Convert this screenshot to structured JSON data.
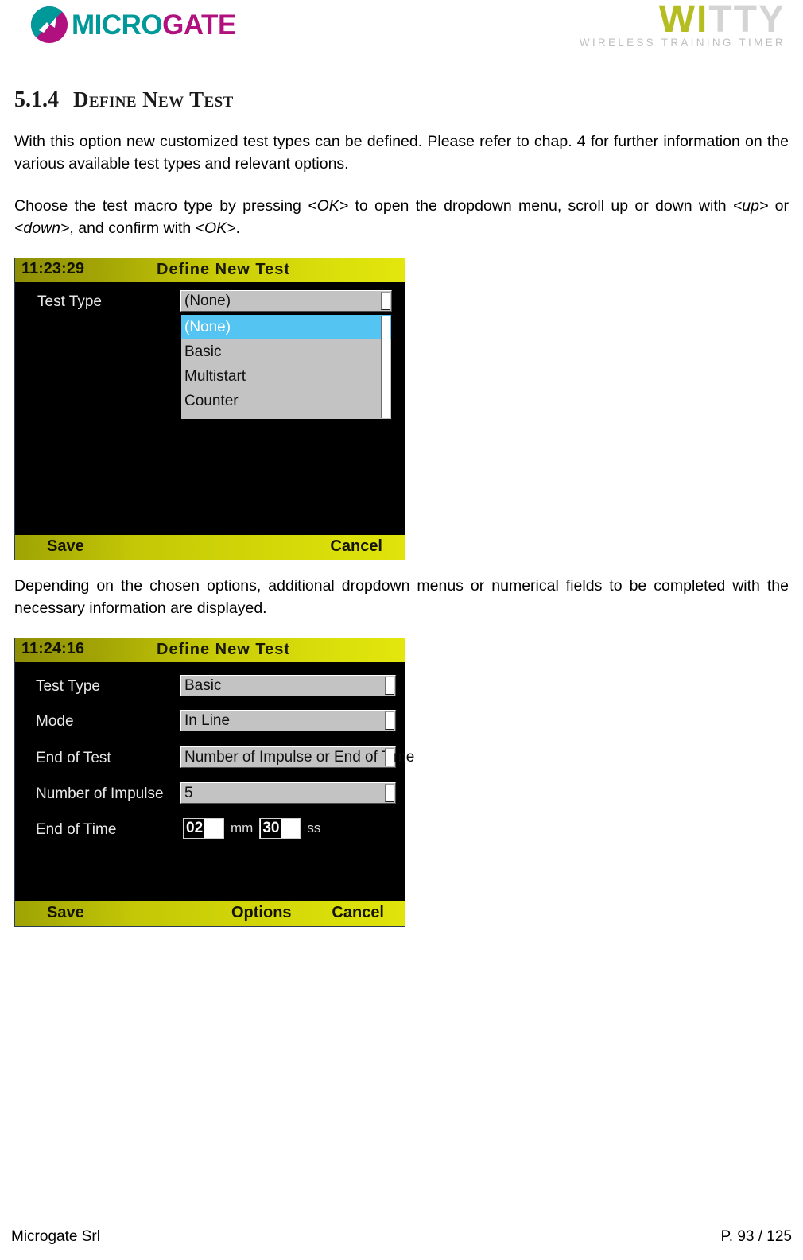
{
  "header": {
    "microgate_logo": {
      "icon": "microgate-circle-mark",
      "word_part1": "MICRO",
      "word_part2": "GATE"
    },
    "witty_logo": {
      "word_part1": "WI",
      "word_part2": "TTY",
      "tagline": "WIRELESS  TRAINING  TIMER"
    }
  },
  "section": {
    "number": "5.1.4",
    "title": "Define New Test"
  },
  "paragraphs": {
    "p1": "With this option new customized test types can be defined. Please refer to chap. 4 for further information on the various available test types and relevant options.",
    "p2_a": "Choose the test macro type by pressing ",
    "p2_ok1": "<OK>",
    "p2_b": " to open the dropdown menu, scroll up or down with ",
    "p2_up": "<up>",
    "p2_c": " or ",
    "p2_down": "<down>",
    "p2_d": ", and confirm with ",
    "p2_ok2": "<OK>",
    "p2_e": ".",
    "p3": "Depending on the chosen options, additional dropdown menus or numerical fields to be completed with the necessary information are displayed."
  },
  "screen1": {
    "time": "11:23:29",
    "title": "Define  New  Test",
    "field_label": "Test Type",
    "combo_value": "(None)",
    "dropdown_options": [
      {
        "label": "(None)",
        "selected": true
      },
      {
        "label": "Basic",
        "selected": false
      },
      {
        "label": "Multistart",
        "selected": false
      },
      {
        "label": "Counter",
        "selected": false
      }
    ],
    "softkey_left": "Save",
    "softkey_right": "Cancel"
  },
  "screen2": {
    "time": "11:24:16",
    "title": "Define  New  Test",
    "fields": [
      {
        "label": "Test Type",
        "value": "Basic",
        "type": "combo"
      },
      {
        "label": "Mode",
        "value": "In Line",
        "type": "combo"
      },
      {
        "label": "End of Test",
        "value": "Number of Impulse or End of Time",
        "type": "combo"
      },
      {
        "label": "Number of Impulse",
        "value": "5",
        "type": "combo"
      }
    ],
    "time_field": {
      "label": "End of Time",
      "minutes": "02",
      "minutes_unit": "mm",
      "seconds": "30",
      "seconds_unit": "ss"
    },
    "softkey_left": "Save",
    "softkey_center": "Options",
    "softkey_right": "Cancel"
  },
  "footer": {
    "company": "Microgate Srl",
    "page": "P. 93 / 125"
  },
  "colors": {
    "brand_teal": "#009999",
    "brand_magenta": "#b0117f",
    "witty_olive": "#b5bd20",
    "witty_gray": "#d4d4d4",
    "device_yellow": "#cfd307",
    "selection_blue": "#54c4f2"
  }
}
